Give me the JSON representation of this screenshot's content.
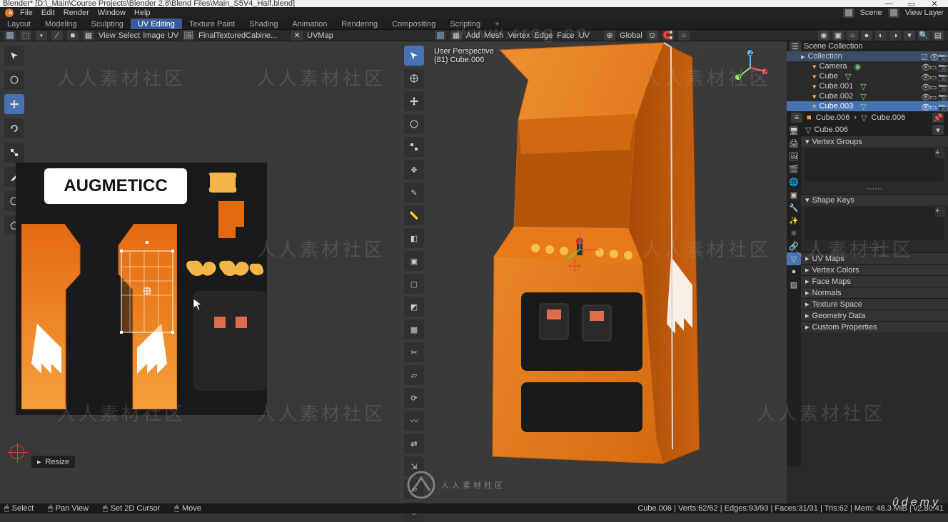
{
  "title": "Blender* [D:\\_Main\\Course Projects\\Blender 2.8\\Blend Files\\Main_S5V4_Half.blend]",
  "topmenu": {
    "items": [
      "File",
      "Edit",
      "Render",
      "Window",
      "Help"
    ]
  },
  "workspaces": {
    "tabs": [
      "Layout",
      "Modeling",
      "Sculpting",
      "UV Editing",
      "Texture Paint",
      "Shading",
      "Animation",
      "Rendering",
      "Compositing",
      "Scripting",
      "+"
    ],
    "active_index": 3
  },
  "topright": {
    "scene": "Scene",
    "viewlayer": "View Layer"
  },
  "watermark_url": "www.rrcg.cn",
  "watermark_text": "人人素材社区",
  "toolheader_uv": {
    "menus": [
      "View",
      "Select",
      "Image",
      "UV"
    ],
    "image_name": "FinalTexturedCabine...",
    "channel": "UVMap"
  },
  "toolheader_3d": {
    "orientation": "Global"
  },
  "uvtools": [
    "cursor",
    "move",
    "rotate",
    "scale",
    "transform",
    "annotate",
    "circle",
    "poly"
  ],
  "vp3d": {
    "header1": "User Perspective",
    "header2": "(81) Cube.006"
  },
  "vp3dtools": [
    "cursor",
    "move",
    "rotate",
    "scale",
    "transform",
    "annotate",
    "measure",
    "add",
    "extrude",
    "inset",
    "bevel",
    "loopcut",
    "knife",
    "poly",
    "spin",
    "smooth",
    "slide",
    "shrink",
    "shear",
    "rip"
  ],
  "texture_label": "AUGMETICC",
  "outliner": {
    "root": "Scene Collection",
    "collection": "Collection",
    "items": [
      {
        "name": "Camera",
        "icon": "camera"
      },
      {
        "name": "Cube",
        "icon": "mesh"
      },
      {
        "name": "Cube.001",
        "icon": "mesh"
      },
      {
        "name": "Cube.002",
        "icon": "mesh"
      },
      {
        "name": "Cube.003",
        "icon": "mesh"
      }
    ]
  },
  "props": {
    "breadcrumb1": "Cube.006",
    "breadcrumb2": "Cube.006",
    "object_name": "Cube.006",
    "panels": [
      "Vertex Groups",
      "Shape Keys",
      "UV Maps",
      "Vertex Colors",
      "Face Maps",
      "Normals",
      "Texture Space",
      "Geometry Data",
      "Custom Properties"
    ]
  },
  "status_tool": "Resize",
  "bottom_hints": {
    "select": "Select",
    "pan": "Pan View",
    "cursor": "Set 2D Cursor",
    "move": "Move"
  },
  "bottom_stats": "Cube.006 | Verts:62/62 | Edges:93/93 | Faces:31/31 | Tris:62 | Mem: 48.3 MiB | v2.80.41",
  "colors": {
    "accent": "#4772b3",
    "orange": "#e87a1a"
  }
}
